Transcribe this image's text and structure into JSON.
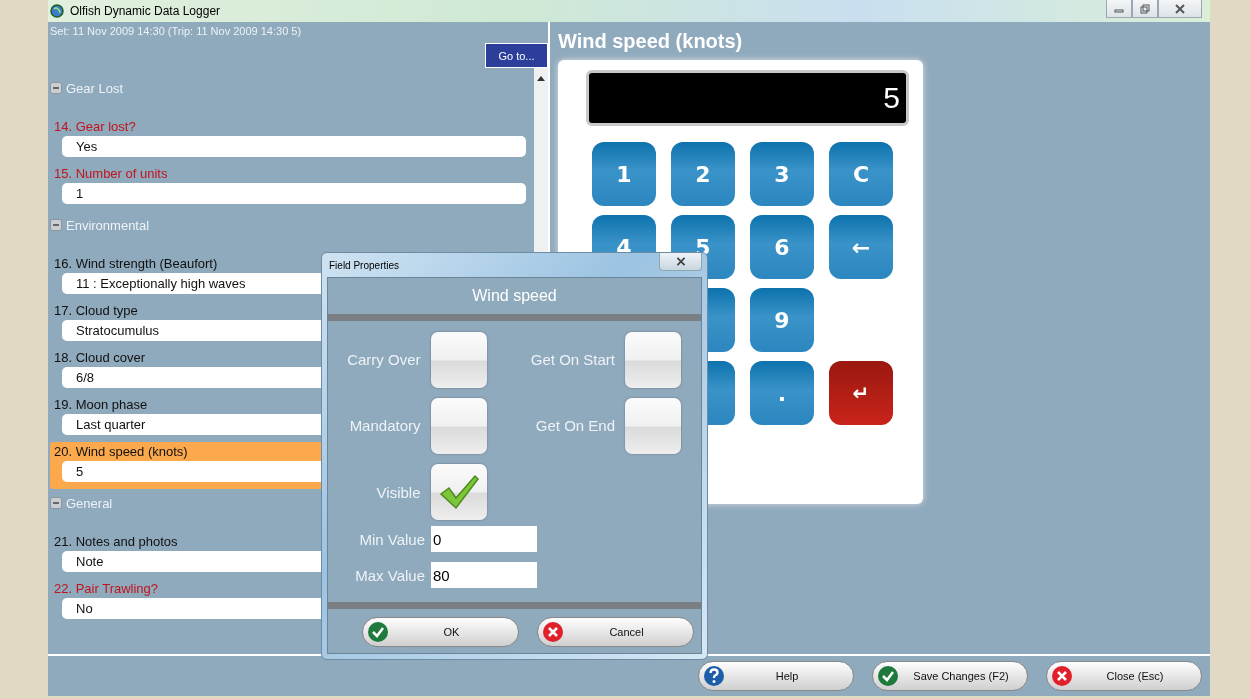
{
  "window": {
    "title": "Olfish Dynamic Data Logger"
  },
  "set_info": "Set: 11 Nov 2009 14:30 (Trip: 11 Nov 2009 14:30 5)",
  "goto_button": "Go to...",
  "sections": [
    {
      "title": "Gear Lost",
      "expanded": true,
      "fields": [
        {
          "label": "14. Gear lost?",
          "value": "Yes",
          "required": true,
          "selected": false
        },
        {
          "label": "15. Number of units",
          "value": "1",
          "required": true,
          "selected": false
        }
      ]
    },
    {
      "title": "Environmental",
      "expanded": true,
      "fields": [
        {
          "label": "16. Wind strength (Beaufort)",
          "value": "11 : Exceptionally high waves",
          "required": false,
          "selected": false
        },
        {
          "label": "17. Cloud type",
          "value": "Stratocumulus",
          "required": false,
          "selected": false
        },
        {
          "label": "18. Cloud cover",
          "value": "6/8",
          "required": false,
          "selected": false
        },
        {
          "label": "19. Moon phase",
          "value": "Last quarter",
          "required": false,
          "selected": false
        },
        {
          "label": "20. Wind speed (knots)",
          "value": "5",
          "required": false,
          "selected": true
        }
      ]
    },
    {
      "title": "General",
      "expanded": true,
      "fields": [
        {
          "label": "21. Notes and photos",
          "value": "Note",
          "required": false,
          "selected": false
        },
        {
          "label": "22. Pair Trawling?",
          "value": "No",
          "required": true,
          "selected": false
        }
      ]
    }
  ],
  "entry": {
    "title": "Wind speed (knots)",
    "display": "5",
    "keys": [
      {
        "kind": "digit",
        "label": "1"
      },
      {
        "kind": "digit",
        "label": "2"
      },
      {
        "kind": "digit",
        "label": "3"
      },
      {
        "kind": "digit",
        "label": "C"
      },
      {
        "kind": "digit",
        "label": "4"
      },
      {
        "kind": "digit",
        "label": "5"
      },
      {
        "kind": "digit",
        "label": "6"
      },
      {
        "kind": "digit",
        "label": "←"
      },
      {
        "kind": "blank"
      },
      {
        "kind": "digit"
      },
      {
        "kind": "digit",
        "label": "9"
      },
      {
        "kind": "blank"
      },
      {
        "kind": "blank"
      },
      {
        "kind": "digit"
      },
      {
        "kind": "digit",
        "label": "."
      },
      {
        "kind": "enter",
        "label": "↵"
      }
    ]
  },
  "dialog": {
    "title": "Field Properties",
    "heading": "Wind speed",
    "options": [
      {
        "label": "Carry Over",
        "checked": false
      },
      {
        "label": "Get On Start",
        "checked": false
      },
      {
        "label": "Mandatory",
        "checked": false
      },
      {
        "label": "Get On End",
        "checked": false
      },
      {
        "label": "Visible",
        "checked": true
      }
    ],
    "min_label": "Min Value",
    "min_value": "0",
    "max_label": "Max Value",
    "max_value": "80",
    "buttons": [
      {
        "kind": "ok",
        "label": "OK"
      },
      {
        "kind": "cancel",
        "label": "Cancel"
      }
    ]
  },
  "footer_buttons": [
    {
      "kind": "help",
      "label": "Help"
    },
    {
      "kind": "ok",
      "label": "Save Changes (F2)"
    },
    {
      "kind": "cancel",
      "label": "Close (Esc)"
    }
  ]
}
